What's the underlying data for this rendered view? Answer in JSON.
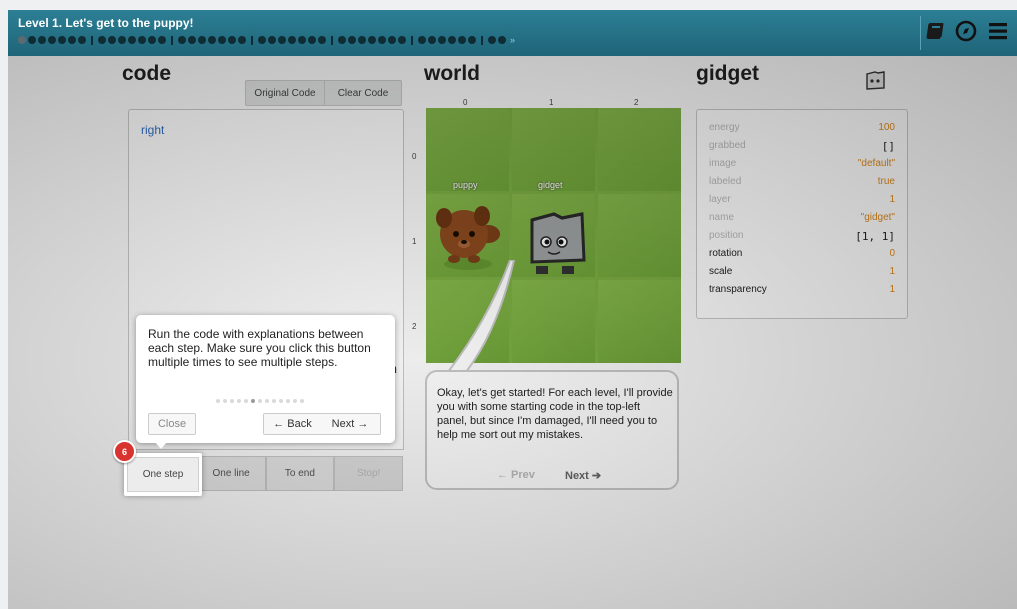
{
  "header": {
    "level_title": "Level 1. Let's get to the puppy!",
    "progress_groups": [
      7,
      7,
      7,
      7,
      7,
      6,
      2
    ],
    "progress_end": "»",
    "icons": [
      "book-icon",
      "compass-icon",
      "menu-icon"
    ]
  },
  "code": {
    "heading": "code",
    "original_code_label": "Original Code",
    "clear_code_label": "Clear Code",
    "lines": [
      "right"
    ],
    "lower_letter": "n",
    "controls": {
      "one_step": "One step",
      "one_line": "One line",
      "to_end": "To end",
      "stop": "Stop!"
    }
  },
  "tutorial": {
    "text": "Run the code with explanations between each step. Make sure you click this button multiple times to see multiple steps.",
    "step_count": 13,
    "current_step": 6,
    "badge": "6",
    "close_label": "Close",
    "back_label": "← Back",
    "next_label": "Next →"
  },
  "world": {
    "heading": "world",
    "columns": [
      "0",
      "1",
      "2"
    ],
    "rows": [
      "0",
      "1",
      "2"
    ],
    "labels": {
      "puppy": "puppy",
      "gidget": "gidget"
    },
    "speech": {
      "text": "Okay, let's get started! For each level, I'll provide you with some starting code in the top-left panel, but since I'm damaged, I'll need you to help me sort out my mistakes.",
      "prev_label": "← Prev",
      "next_label": "Next ➔"
    }
  },
  "gidget": {
    "heading": "gidget",
    "properties": [
      {
        "name": "energy",
        "value": "100",
        "strong": false,
        "dark": false
      },
      {
        "name": "grabbed",
        "value": "[]",
        "strong": false,
        "dark": true
      },
      {
        "name": "image",
        "value": "\"default\"",
        "strong": false,
        "dark": false
      },
      {
        "name": "labeled",
        "value": "true",
        "strong": false,
        "dark": false
      },
      {
        "name": "layer",
        "value": "1",
        "strong": false,
        "dark": false
      },
      {
        "name": "name",
        "value": "\"gidget\"",
        "strong": false,
        "dark": false
      },
      {
        "name": "position",
        "value": "[1, 1]",
        "strong": false,
        "dark": true
      },
      {
        "name": "rotation",
        "value": "0",
        "strong": true,
        "dark": false
      },
      {
        "name": "scale",
        "value": "1",
        "strong": true,
        "dark": false
      },
      {
        "name": "transparency",
        "value": "1",
        "strong": true,
        "dark": false
      }
    ]
  },
  "colors": {
    "header": "#1f6478",
    "grass": "#7cae43",
    "value": "#e08a1a",
    "badge": "#d8332e"
  }
}
